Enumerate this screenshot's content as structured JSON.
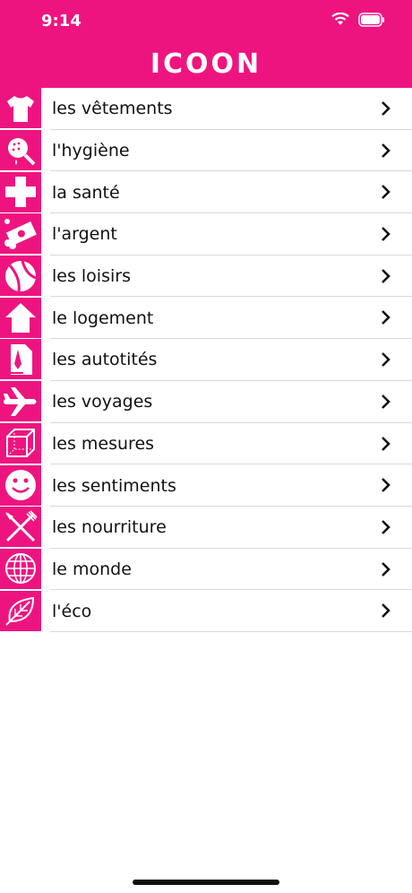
{
  "status_bar": {
    "time": "9:14"
  },
  "header": {
    "title": "ICOON"
  },
  "categories": [
    {
      "label": "les vêtements",
      "icon": "tshirt-icon"
    },
    {
      "label": "l'hygiène",
      "icon": "shower-icon"
    },
    {
      "label": "la santé",
      "icon": "cross-icon"
    },
    {
      "label": "l'argent",
      "icon": "money-icon"
    },
    {
      "label": "les loisirs",
      "icon": "beach-ball-icon"
    },
    {
      "label": "le logement",
      "icon": "house-icon"
    },
    {
      "label": "les autotités",
      "icon": "document-pen-icon"
    },
    {
      "label": "les voyages",
      "icon": "airplane-icon"
    },
    {
      "label": "les mesures",
      "icon": "cube-icon"
    },
    {
      "label": "les sentiments",
      "icon": "smiley-icon"
    },
    {
      "label": "les nourriture",
      "icon": "fork-knife-icon"
    },
    {
      "label": "le monde",
      "icon": "globe-icon"
    },
    {
      "label": "l'éco",
      "icon": "leaf-icon"
    }
  ],
  "colors": {
    "accent": "#ee1480",
    "text": "#111111",
    "background": "#ffffff"
  }
}
